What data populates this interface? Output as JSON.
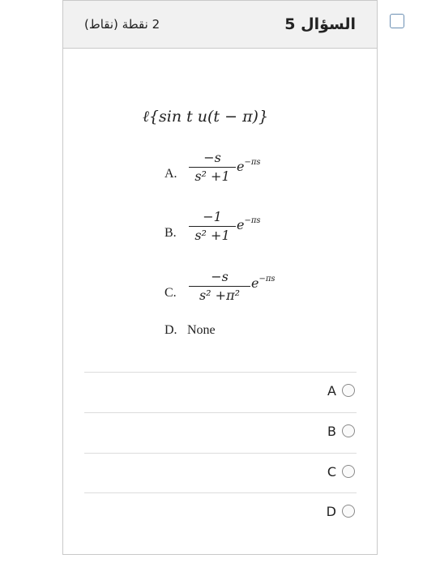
{
  "header": {
    "question_number": "السؤال 5",
    "points": "2 نقطة (نقاط)"
  },
  "question": {
    "stem": "ℓ{sin t u(t − π)}",
    "options": [
      {
        "label": "A.",
        "numerator": "−s",
        "denominator": "s² +1",
        "exponent": "−πs"
      },
      {
        "label": "B.",
        "numerator": "−1",
        "denominator": "s² +1",
        "exponent": "−πs"
      },
      {
        "label": "C.",
        "numerator": "−s",
        "denominator": "s² +π²",
        "exponent": "−πs"
      },
      {
        "label": "D.",
        "text": "None"
      }
    ]
  },
  "answers": [
    {
      "letter": "A"
    },
    {
      "letter": "B"
    },
    {
      "letter": "C"
    },
    {
      "letter": "D"
    }
  ],
  "colors": {
    "flag_border": "#6b8fb3",
    "header_bg": "#f1f1f1",
    "card_border": "#c9c9c9"
  },
  "icons": {
    "flag": "flag-checkbox-icon",
    "radio": "radio-unchecked-icon"
  }
}
